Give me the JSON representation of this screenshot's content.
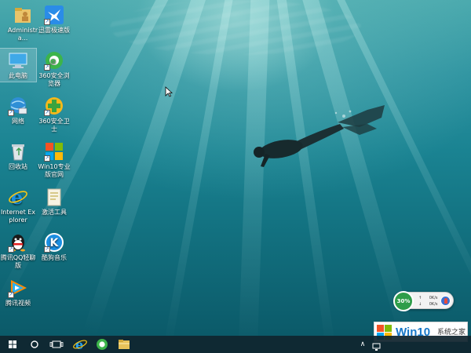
{
  "desktop": {
    "icons": [
      {
        "label": "Administra...",
        "icon": "user-folder-icon"
      },
      {
        "label": "迅雷极速版",
        "icon": "thunder-bird-icon"
      },
      {
        "label": "此电脑",
        "icon": "this-pc-icon"
      },
      {
        "label": "360安全浏览器",
        "icon": "360-browser-icon"
      },
      {
        "label": "网络",
        "icon": "network-icon"
      },
      {
        "label": "360安全卫士",
        "icon": "360-safeguard-icon"
      },
      {
        "label": "回收站",
        "icon": "recycle-bin-icon"
      },
      {
        "label": "Win10专业版官网",
        "icon": "win10-pro-site-icon"
      },
      {
        "label": "Internet Explorer",
        "icon": "internet-explorer-icon"
      },
      {
        "label": "激活工具",
        "icon": "activation-tool-icon"
      },
      {
        "label": "腾讯QQ轻聊版",
        "icon": "qq-lite-icon"
      },
      {
        "label": "酷狗音乐",
        "icon": "kugou-music-icon"
      },
      {
        "label": "腾讯视频",
        "icon": "tencent-video-icon"
      }
    ]
  },
  "network_widget": {
    "percent": "30%",
    "upload": "0K/s",
    "download": "0K/s",
    "upload_arrow": "↑",
    "download_arrow": "↓"
  },
  "watermark": {
    "brand": "Win10",
    "subtitle": "系统之家"
  },
  "taskbar": {
    "pinned": [
      "start-icon",
      "cortana-icon",
      "task-view-icon",
      "internet-explorer-icon",
      "360-browser-icon",
      "file-explorer-icon"
    ],
    "tray_chevron": "∧"
  },
  "colors": {
    "taskbar": "#0f232d",
    "accent_blue": "#1677c8",
    "widget_green": "#2e9d4a"
  }
}
